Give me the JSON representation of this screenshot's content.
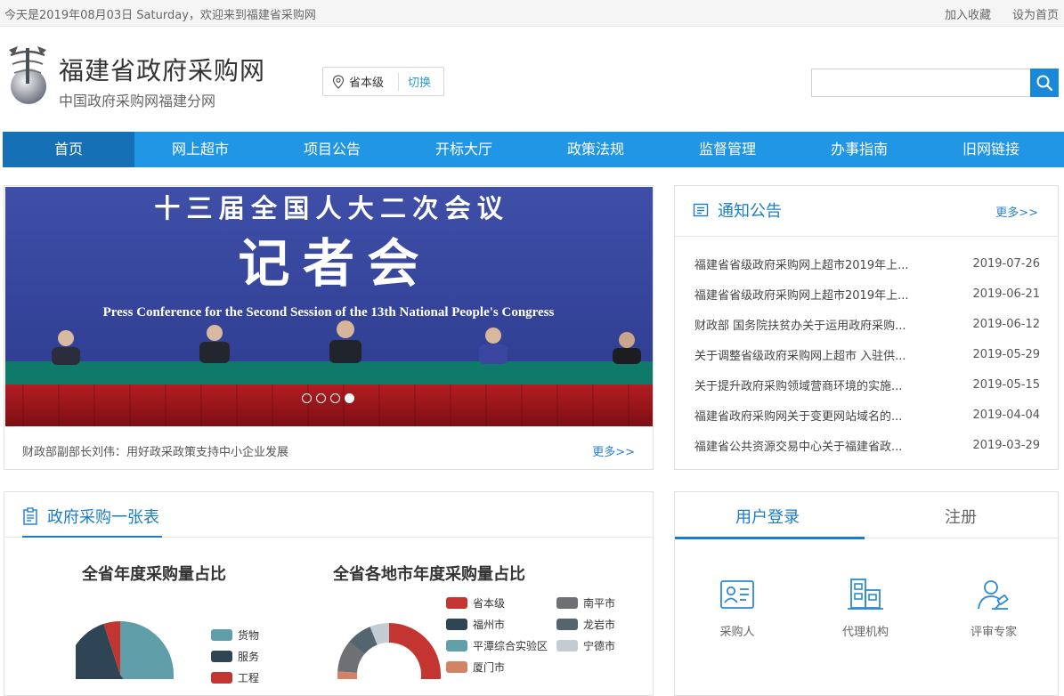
{
  "topbar": {
    "date_text": "今天是2019年08月03日 Saturday，欢迎来到福建省采购网",
    "favorite": "加入收藏",
    "homepage": "设为首页"
  },
  "header": {
    "title": "福建省政府采购网",
    "subtitle": "中国政府采购网福建分网",
    "region_name": "省本级",
    "region_switch": "切换",
    "search_placeholder": ""
  },
  "nav": [
    {
      "label": "首页",
      "active": true
    },
    {
      "label": "网上超市"
    },
    {
      "label": "项目公告"
    },
    {
      "label": "开标大厅"
    },
    {
      "label": "政策法规"
    },
    {
      "label": "监督管理"
    },
    {
      "label": "办事指南"
    },
    {
      "label": "旧网链接"
    }
  ],
  "banner": {
    "photo_line1": "十 三 届 全 国 人 大 二 次 会 议",
    "photo_line2": "记 者 会",
    "photo_line3": "Press Conference for the Second Session of the 13th National People's Congress",
    "caption": "财政部副部长刘伟：用好政采政策支持中小企业发展",
    "more": "更多>>",
    "slide_count": 4,
    "active_slide": 4
  },
  "notice": {
    "title": "通知公告",
    "more": "更多>>",
    "items": [
      {
        "title": "福建省省级政府采购网上超市2019年上...",
        "date": "2019-07-26"
      },
      {
        "title": "福建省省级政府采购网上超市2019年上...",
        "date": "2019-06-21"
      },
      {
        "title": "财政部 国务院扶贫办关于运用政府采购...",
        "date": "2019-06-12"
      },
      {
        "title": "关于调整省级政府采购网上超市 入驻供...",
        "date": "2019-05-29"
      },
      {
        "title": "关于提升政府采购领域营商环境的实施...",
        "date": "2019-05-15"
      },
      {
        "title": "福建省政府采购网关于变更网站域名的...",
        "date": "2019-04-04"
      },
      {
        "title": "福建省公共资源交易中心关于福建省政...",
        "date": "2019-03-29"
      }
    ]
  },
  "ptable": {
    "title": "政府采购一张表"
  },
  "chart_data": [
    {
      "type": "pie",
      "title": "全省年度采购量占比",
      "series": [
        {
          "name": "货物",
          "color": "#5f9ea8"
        },
        {
          "name": "服务",
          "color": "#2f4454"
        },
        {
          "name": "工程",
          "color": "#c23531"
        }
      ]
    },
    {
      "type": "pie",
      "title": "全省各地市年度采购量占比",
      "series": [
        {
          "name": "省本级",
          "color": "#c23531"
        },
        {
          "name": "福州市",
          "color": "#2f4554"
        },
        {
          "name": "平潭综合实验区",
          "color": "#61a0a8"
        },
        {
          "name": "厦门市",
          "color": "#d48265"
        },
        {
          "name": "南平市",
          "color": "#6e7074"
        },
        {
          "name": "龙岩市",
          "color": "#546570"
        },
        {
          "name": "宁德市",
          "color": "#c4ccd3"
        }
      ]
    }
  ],
  "login": {
    "tab_login": "用户登录",
    "tab_register": "注册",
    "roles": [
      {
        "label": "采购人",
        "icon": "id-card-icon"
      },
      {
        "label": "代理机构",
        "icon": "building-icon"
      },
      {
        "label": "评审专家",
        "icon": "expert-icon"
      }
    ]
  },
  "colors": {
    "nav": "#2196e5",
    "nav_active": "#1570b5",
    "accent": "#1a7dc9"
  }
}
